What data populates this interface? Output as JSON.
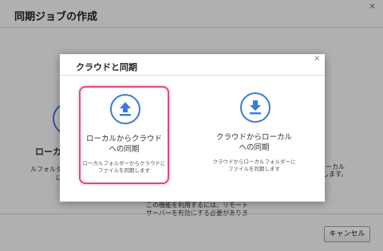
{
  "background_window": {
    "title": "同期ジョブの作成",
    "close": "×",
    "left_option_label": "ローカル",
    "left_desc_line1": "ルフォルダー",
    "left_desc_line2": "に",
    "right_desc_line1": "からローカル",
    "right_desc_line2": "同期します。",
    "note_line1": "この機能を利用するには、リモート",
    "note_line2": "サーバーを有効にする必要がありま",
    "cancel_label": "キャンセル"
  },
  "dialog": {
    "title": "クラウドと同期",
    "close": "×",
    "options": [
      {
        "label_line1": "ローカルからクラウド",
        "label_line2": "への同期",
        "desc_line1": "ローカルフォルダーからクラウドに",
        "desc_line2": "ファイルを同期します",
        "icon": "upload-arrow-icon",
        "selected": true
      },
      {
        "label_line1": "クラウドからローカル",
        "label_line2": "への同期",
        "desc_line1": "クラウドからローカルフォルダーに",
        "desc_line2": "ファイルを同期します",
        "icon": "download-arrow-icon",
        "selected": false
      }
    ]
  },
  "colors": {
    "accent_blue": "#3a7ad8",
    "selection_pink": "#e8457a"
  }
}
